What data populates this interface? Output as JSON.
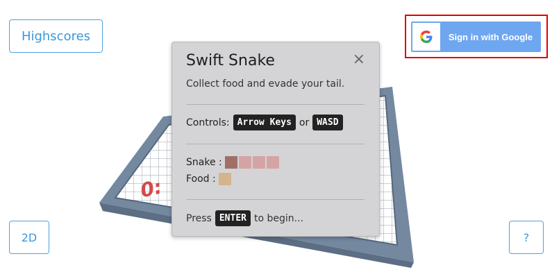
{
  "buttons": {
    "highscores": "Highscores",
    "mode_2d": "2D",
    "help": "?",
    "google_signin": "Sign in with Google"
  },
  "board_text": "0:",
  "modal": {
    "title": "Swift Snake",
    "close": "×",
    "subtitle": "Collect food and evade your tail.",
    "controls_label": "Controls:",
    "key_arrows": "Arrow Keys",
    "or_text": "or",
    "key_wasd": "WASD",
    "snake_label": "Snake :",
    "food_label": "Food :",
    "press_text": "Press",
    "key_enter": "ENTER",
    "begin_text": "to begin..."
  },
  "colors": {
    "snake_head": "#a07068",
    "snake_body": "#d4a4a4",
    "food": "#d4b48c",
    "board_frame": "#6d8099",
    "accent_blue": "#3a98db",
    "google_blue": "#6fa6f0",
    "highlight_red": "#e00000"
  },
  "icons": {
    "google": "google-g-icon"
  }
}
